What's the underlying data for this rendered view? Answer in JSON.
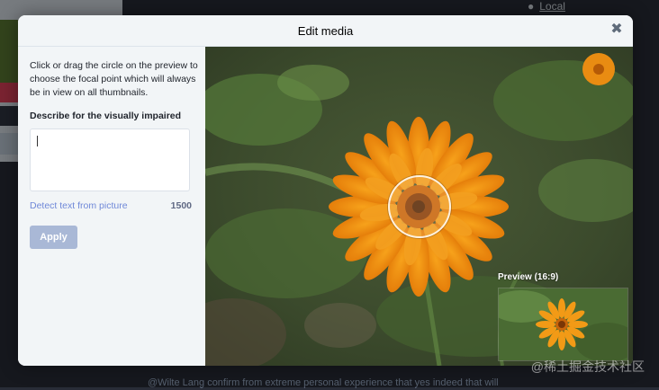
{
  "background": {
    "local_label": "Local",
    "post_text": "@Wilte Lang confirm from extreme personal experience that yes indeed that will"
  },
  "modal": {
    "title": "Edit media",
    "close_icon": "close-icon",
    "hint": "Click or drag the circle on the preview to choose the focal point which will always be in view on all thumbnails.",
    "description_label": "Describe for the visually impaired",
    "description_value": "",
    "detect_text_label": "Detect text from picture",
    "char_count": "1500",
    "apply_label": "Apply",
    "preview_label": "Preview (16:9)"
  },
  "watermark": "@稀土掘金技术社区"
}
